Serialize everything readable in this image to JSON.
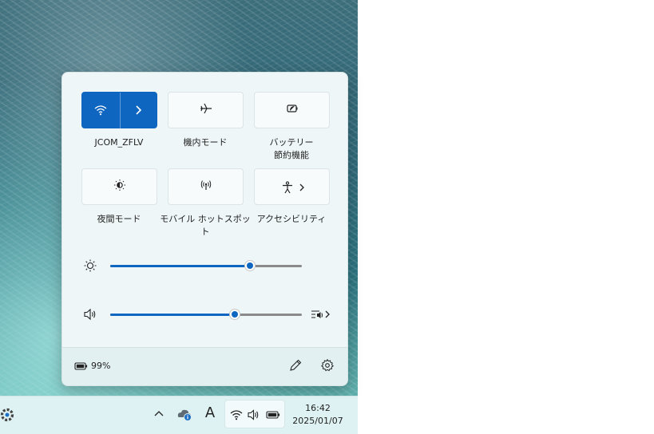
{
  "quick_settings": {
    "tiles": [
      {
        "label": "JCOM_ZFLV",
        "icon": "wifi-icon",
        "active": true
      },
      {
        "label": "機内モード",
        "icon": "airplane-icon",
        "active": false
      },
      {
        "label_lines": [
          "バッテリー",
          "節約機能"
        ],
        "icon": "battery-saver-icon",
        "active": false
      },
      {
        "label": "夜間モード",
        "icon": "night-light-icon",
        "active": false
      },
      {
        "label_lines": [
          "モバイル ホットスポッ",
          "ト"
        ],
        "icon": "hotspot-icon",
        "active": false
      },
      {
        "label": "アクセシビリティ",
        "icon": "accessibility-icon",
        "active": false
      }
    ],
    "brightness": {
      "icon": "brightness-icon",
      "level": 0.73
    },
    "volume": {
      "icon": "speaker-icon",
      "level": 0.65
    },
    "footer": {
      "battery_percent": "99%"
    }
  },
  "taskbar": {
    "clock_time": "16:42",
    "clock_date": "2025/01/07",
    "ime_label": "A"
  },
  "colors": {
    "accent": "#0f66c0",
    "panel": "#eef6f7",
    "taskbar": "#dff2f3"
  }
}
